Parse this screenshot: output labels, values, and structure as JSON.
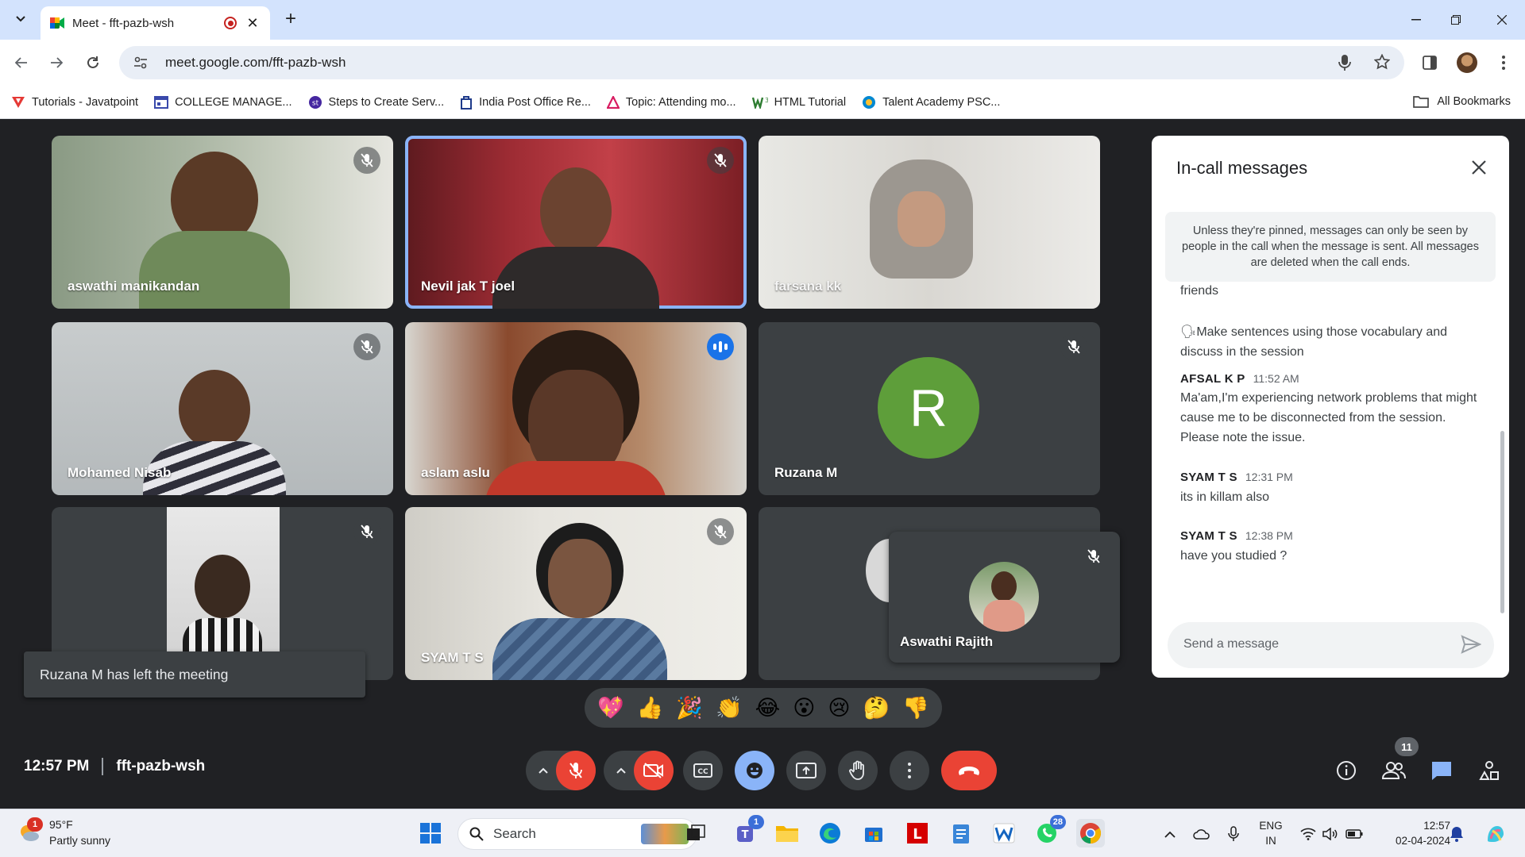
{
  "browser": {
    "tab_title": "Meet - fft-pazb-wsh",
    "url": "meet.google.com/fft-pazb-wsh",
    "bookmarks": [
      {
        "label": "Tutorials - Javatpoint",
        "color": "#e53935"
      },
      {
        "label": "COLLEGE MANAGE...",
        "color": "#3949ab"
      },
      {
        "label": "Steps to Create Serv...",
        "color": "#4527a0"
      },
      {
        "label": "India Post Office Re...",
        "color": "#1e3a8a"
      },
      {
        "label": "Topic: Attending mo...",
        "color": "#d81b60"
      },
      {
        "label": "HTML Tutorial",
        "color": "#2e7d32"
      },
      {
        "label": "Talent Academy PSC...",
        "color": "#0288d1"
      }
    ],
    "all_bookmarks": "All Bookmarks"
  },
  "participants": [
    {
      "name": "aswathi manikandan",
      "muted": true
    },
    {
      "name": "Nevil jak T joel",
      "muted": true,
      "active": true
    },
    {
      "name": "farsana kk",
      "muted": false
    },
    {
      "name": "Mohamed Nisab",
      "muted": true
    },
    {
      "name": "aslam aslu",
      "speaking": true
    },
    {
      "name": "Ruzana M",
      "muted": true,
      "initial": "R"
    },
    {
      "name": "",
      "muted": true
    },
    {
      "name": "SYAM T S",
      "muted": true
    },
    {
      "name": "Aswathi Rajith",
      "muted": true
    }
  ],
  "toast": "Ruzana M has left the meeting",
  "chat": {
    "title": "In-call messages",
    "notice": "Unless they're pinned, messages can only be seen by people in the call when the message is sent. All messages are deleted when the call ends.",
    "partial_text": "friends",
    "bullet_text": "🗣Make sentences using those vocabulary and discuss in the session",
    "messages": [
      {
        "sender": "AFSAL K P",
        "time": "11:52 AM",
        "text": "Ma'am,I'm experiencing network problems that might cause me to be disconnected from the session. Please note the issue."
      },
      {
        "sender": "SYAM T S",
        "time": "12:31 PM",
        "text": "its in killam also"
      },
      {
        "sender": "SYAM T S",
        "time": "12:38 PM",
        "text": "have you studied ?"
      }
    ],
    "input_placeholder": "Send a message"
  },
  "reactions": [
    "💖",
    "👍",
    "🎉",
    "👏",
    "😂",
    "😮",
    "😢",
    "🤔",
    "👎"
  ],
  "meeting": {
    "time": "12:57 PM",
    "code": "fft-pazb-wsh",
    "participant_count": "11"
  },
  "taskbar": {
    "weather_temp": "95°F",
    "weather_desc": "Partly sunny",
    "weather_badge": "1",
    "search_label": "Search",
    "teams_badge": "1",
    "whatsapp_badge": "28",
    "lang_1": "ENG",
    "lang_2": "IN",
    "clock_time": "12:57",
    "clock_date": "02-04-2024"
  }
}
